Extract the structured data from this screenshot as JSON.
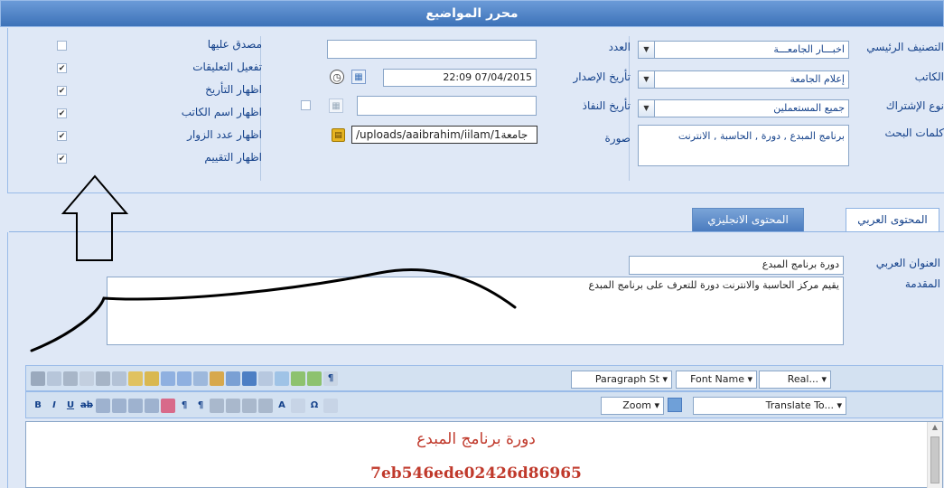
{
  "window": {
    "title": "محرر المواضيع"
  },
  "form": {
    "main_category_label": "التصنيف الرئيسي",
    "main_category_value": "اخبـــار الجامعـــة",
    "writer_label": "الكاتب",
    "writer_value": "إعلام الجامعة",
    "subscription_label": "نوع الإشتراك",
    "subscription_value": "جميع المستعملين",
    "keywords_label": "كلمات البحث",
    "keywords_value": "برنامج المبدع , دورة , الحاسبة , الانترنت",
    "number_label": "العدد",
    "number_value": "",
    "issue_date_label": "تأريخ الإصدار",
    "issue_date_value": "22:09 07/04/2015",
    "expiry_date_label": "تأريخ النفاذ",
    "expiry_date_value": "",
    "image_label": "صورة",
    "image_value": "/uploads/aaibrahim/iilam/1جامعة"
  },
  "options": [
    {
      "label": "مصدق عليها",
      "checked": false
    },
    {
      "label": "تفعيل التعليقات",
      "checked": true
    },
    {
      "label": "اظهار التأريخ",
      "checked": true
    },
    {
      "label": "اظهار اسم الكاتب",
      "checked": true
    },
    {
      "label": "اظهار عدد الزوار",
      "checked": true
    },
    {
      "label": "اظهار التقييم",
      "checked": true
    }
  ],
  "tabs": [
    {
      "label": "المحتوى العربي",
      "active": true
    },
    {
      "label": "المحتوى الانجليزي",
      "active": false
    }
  ],
  "content": {
    "arabic_title_label": "العنوان العربي",
    "arabic_title_value": "دورة برنامج المبدع",
    "intro_label": "المقدمة",
    "intro_value": "يقيم مركز الحاسبة والانترنت دورة للتعرف على برنامج المبدع"
  },
  "toolbar": {
    "paragraph_style": "Paragraph St",
    "font_name": "Font Name",
    "font_size": "Real...",
    "zoom": "Zoom",
    "translate": "Translate To..."
  },
  "editor": {
    "line1": "دورة برنامج المبدع",
    "line2": "7eb546ede02426d86965"
  },
  "colors": {
    "accent": "#15428b",
    "editor_text": "#c0392b",
    "background": "#dfe8f6"
  }
}
